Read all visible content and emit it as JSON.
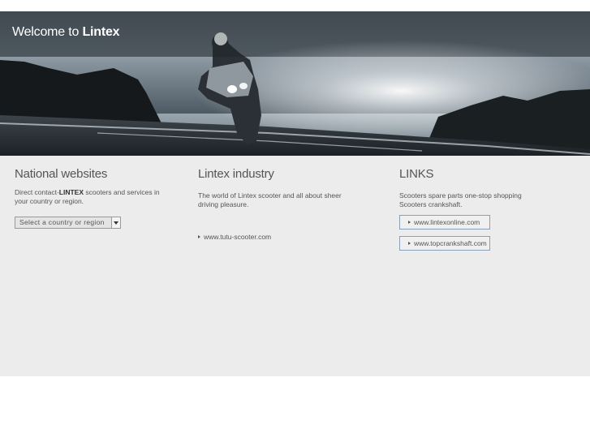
{
  "hero": {
    "welcome": "Welcome to",
    "brand": "Lintex"
  },
  "national": {
    "title": "National websites",
    "desc_prefix": "Direct contact-",
    "desc_bold": "LINTEX",
    "desc_suffix": " scooters and services in your country or region.",
    "select_value": "Select a country or region"
  },
  "industry": {
    "title": "Lintex industry",
    "desc": "The world of Lintex scooter and all about sheer driving pleasure.",
    "link": "www.tutu-scooter.com"
  },
  "links": {
    "title": "LINKS",
    "desc_line1": "Scooters spare parts one-stop shopping",
    "desc_line2": "Scooters crankshaft.",
    "items": [
      {
        "label": "www.lintexonline.com"
      },
      {
        "label": "www.topcrankshaft.com"
      }
    ]
  },
  "icons": [
    "chevron-down-icon",
    "arrow-right-icon"
  ]
}
